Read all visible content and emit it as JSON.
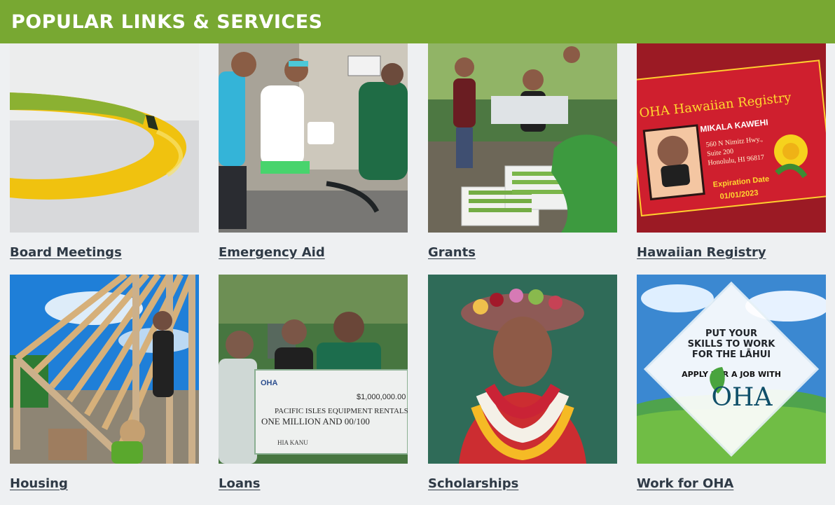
{
  "header": {
    "title": "POPULAR LINKS & SERVICES"
  },
  "tiles": [
    {
      "label": "Board Meetings"
    },
    {
      "label": "Emergency Aid"
    },
    {
      "label": "Grants"
    },
    {
      "label": "Hawaiian Registry"
    },
    {
      "label": "Housing"
    },
    {
      "label": "Loans"
    },
    {
      "label": "Scholarships"
    },
    {
      "label": "Work for OHA"
    }
  ],
  "images": {
    "registry_card": {
      "title": "OHA Hawaiian Registry",
      "name": "MIKALA KAWEHI",
      "address_line_1": "560 N Nimitz Hwy.,",
      "address_line_2": "Suite 200",
      "address_line_3": "Honolulu, HI 96817",
      "expiration_label": "Expiration Date",
      "expiration_date": "01/01/2023"
    },
    "loans_check": {
      "logo": "OHA",
      "amount": "$1,000,000.00",
      "payee": "PACIFIC ISLES EQUIPMENT RENTALS INC",
      "written_amount": "ONE MILLION AND 00/100",
      "memo": "HIA KANU"
    },
    "jobs_banner": {
      "line_1": "PUT YOUR",
      "line_2": "SKILLS TO WORK",
      "line_3": "FOR THE LĀHUI",
      "line_4": "APPLY FOR A JOB WITH",
      "logo": "OHA"
    }
  }
}
